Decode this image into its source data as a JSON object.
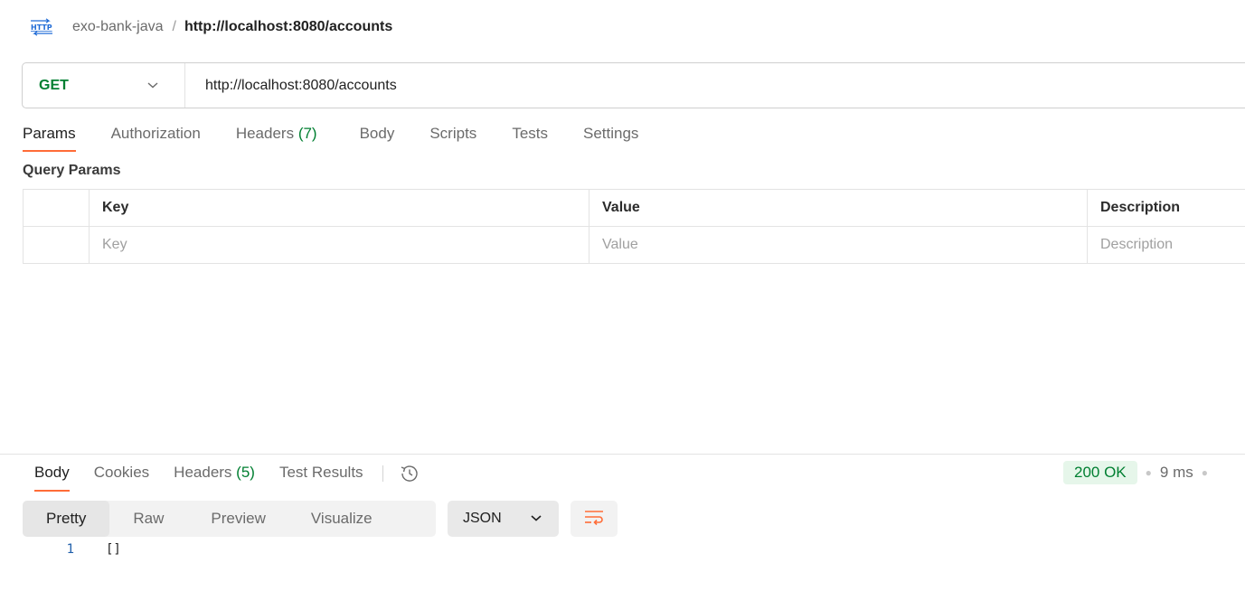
{
  "breadcrumb": {
    "icon": "http-icon",
    "collection": "exo-bank-java",
    "separator": "/",
    "current": "http://localhost:8080/accounts"
  },
  "request": {
    "method": "GET",
    "url": "http://localhost:8080/accounts",
    "colors": {
      "method": "#007f31",
      "accent": "#ff6c37"
    }
  },
  "request_tabs": {
    "params": "Params",
    "authorization": "Authorization",
    "headers": "Headers",
    "headers_count": "(7)",
    "body": "Body",
    "scripts": "Scripts",
    "tests": "Tests",
    "settings": "Settings",
    "active": "Params"
  },
  "query_params": {
    "title": "Query Params",
    "columns": [
      "Key",
      "Value",
      "Description"
    ],
    "placeholders": {
      "key": "Key",
      "value": "Value",
      "description": "Description"
    }
  },
  "response": {
    "tabs": {
      "body": "Body",
      "cookies": "Cookies",
      "headers": "Headers",
      "headers_count": "(5)",
      "test_results": "Test Results",
      "active": "Body"
    },
    "status": "200 OK",
    "time": "9 ms",
    "formats": [
      "Pretty",
      "Raw",
      "Preview",
      "Visualize"
    ],
    "active_format": "Pretty",
    "language": "JSON",
    "code_lines": [
      {
        "number": "1",
        "text": "[]"
      }
    ]
  }
}
